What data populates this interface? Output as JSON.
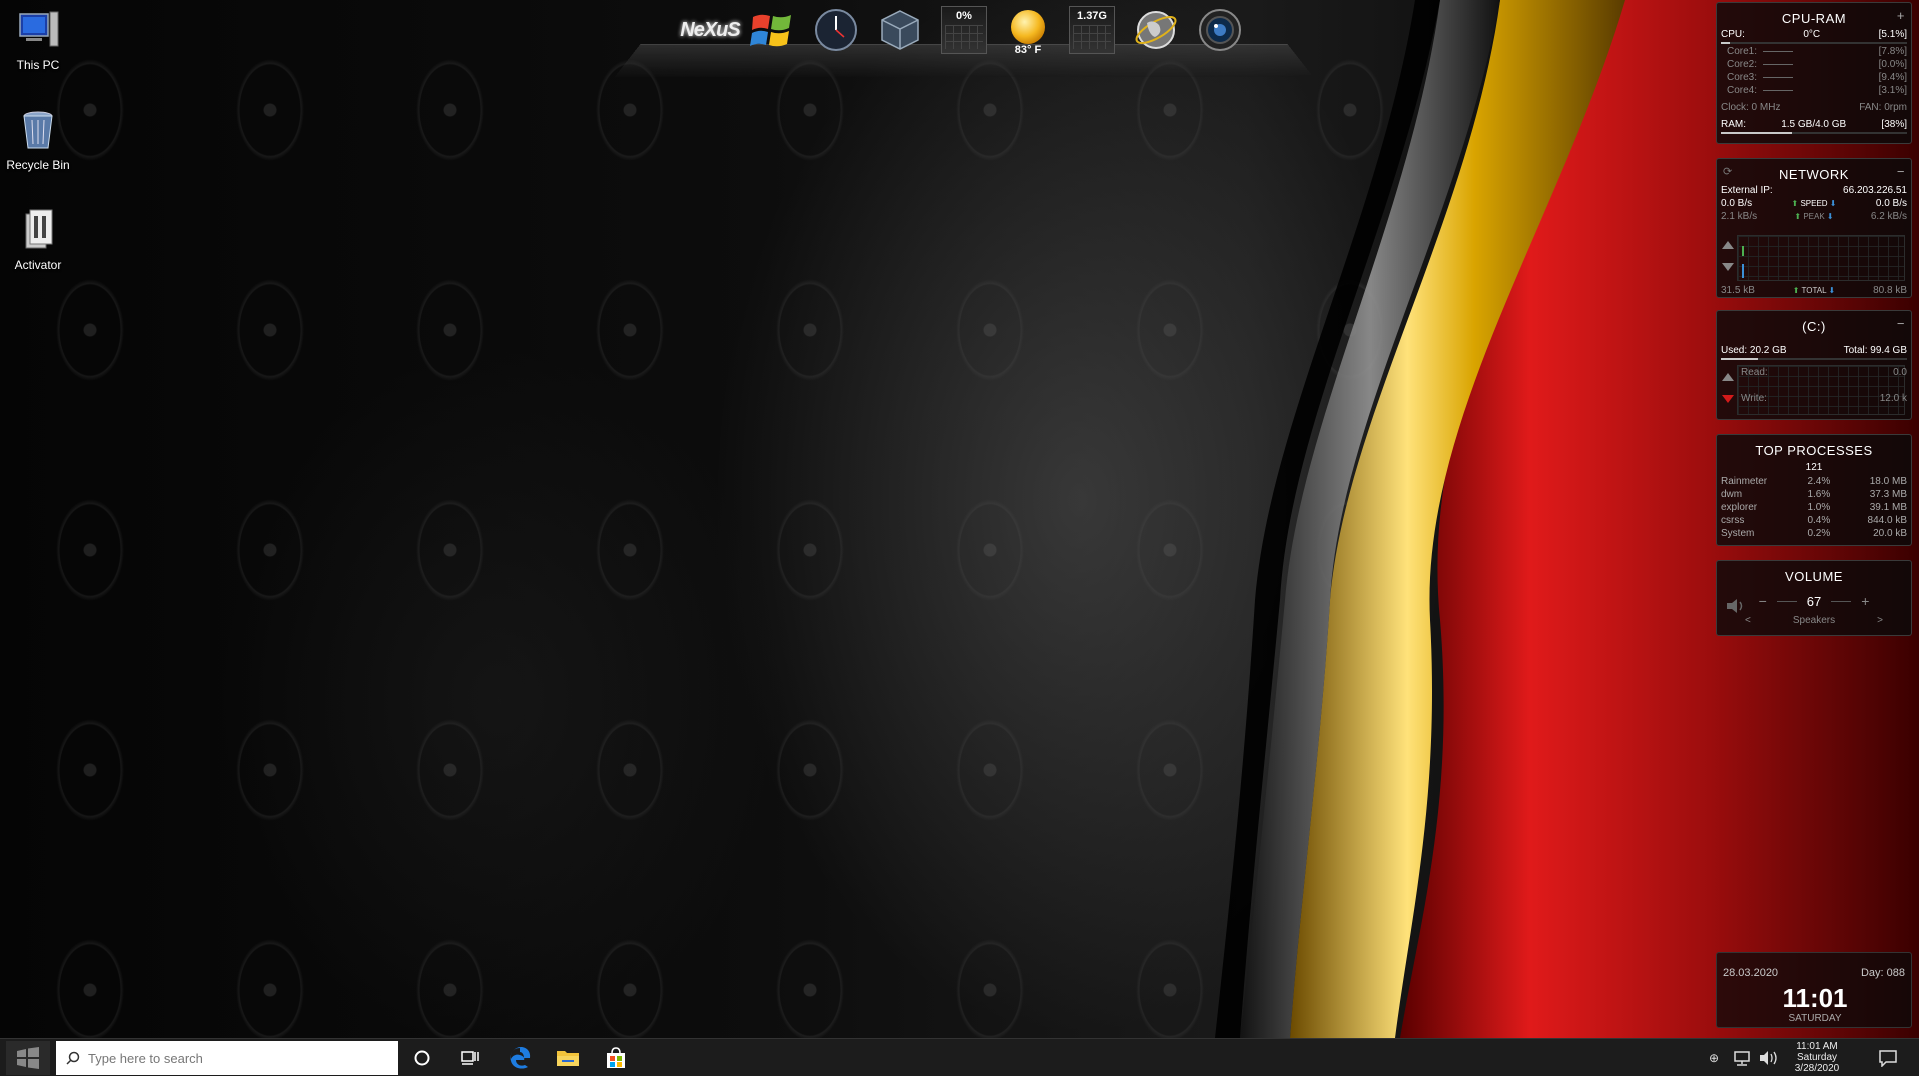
{
  "desktop": {
    "icons": [
      {
        "label": "This PC"
      },
      {
        "label": "Recycle Bin"
      },
      {
        "label": "Activator"
      }
    ]
  },
  "dock": {
    "logo": "NeXuS",
    "cpu_meter": "0%",
    "weather_temp": "83° F",
    "ram_meter": "1.37G"
  },
  "cpu_ram": {
    "title": "CPU-RAM",
    "cpu_label": "CPU:",
    "cpu_temp": "0°C",
    "cpu_percent": "[5.1%]",
    "cores": [
      {
        "label": "Core1:",
        "value": "[7.8%]"
      },
      {
        "label": "Core2:",
        "value": "[0.0%]"
      },
      {
        "label": "Core3:",
        "value": "[9.4%]"
      },
      {
        "label": "Core4:",
        "value": "[3.1%]"
      }
    ],
    "clock": "Clock: 0 MHz",
    "fan": "FAN: 0rpm",
    "ram_label": "RAM:",
    "ram_value": "1.5 GB/4.0 GB",
    "ram_percent": "[38%]",
    "ram_fraction": 0.38
  },
  "network": {
    "title": "NETWORK",
    "external_ip_label": "External IP:",
    "external_ip": "66.203.226.51",
    "up_speed": "0.0 B/s",
    "speed_label": "SPEED",
    "down_speed": "0.0 B/s",
    "up_peak": "2.1 kB/s",
    "peak_label": "PEAK",
    "down_peak": "6.2 kB/s",
    "total_up": "31.5 kB",
    "total_label": "TOTAL",
    "total_down": "80.8 kB"
  },
  "drive": {
    "title": "(C:)",
    "used": "Used: 20.2 GB",
    "total": "Total: 99.4 GB",
    "read_label": "Read:",
    "read_value": "0.0",
    "write_label": "Write:",
    "write_value": "12.0 k"
  },
  "processes": {
    "title": "TOP PROCESSES",
    "count": "121",
    "rows": [
      {
        "name": "Rainmeter",
        "cpu": "2.4%",
        "mem": "18.0 MB"
      },
      {
        "name": "dwm",
        "cpu": "1.6%",
        "mem": "37.3 MB"
      },
      {
        "name": "explorer",
        "cpu": "1.0%",
        "mem": "39.1 MB"
      },
      {
        "name": "csrss",
        "cpu": "0.4%",
        "mem": "844.0 kB"
      },
      {
        "name": "System",
        "cpu": "0.2%",
        "mem": "20.0 kB"
      }
    ]
  },
  "volume": {
    "title": "VOLUME",
    "minus": "−",
    "level": "67",
    "plus": "+",
    "prev": "<",
    "device": "Speakers",
    "next": ">"
  },
  "clock": {
    "date": "28.03.2020",
    "day_of_year": "Day: 088",
    "time": "11:01",
    "weekday": "SATURDAY"
  },
  "taskbar": {
    "search_placeholder": "Type here to search",
    "tray_time": "11:01 AM",
    "tray_day": "Saturday",
    "tray_date": "3/28/2020"
  },
  "colors": {
    "accent_red": "#c4161c",
    "accent_gold": "#e0b21a",
    "network_up": "#4caf50",
    "network_down": "#3b8fd6"
  }
}
